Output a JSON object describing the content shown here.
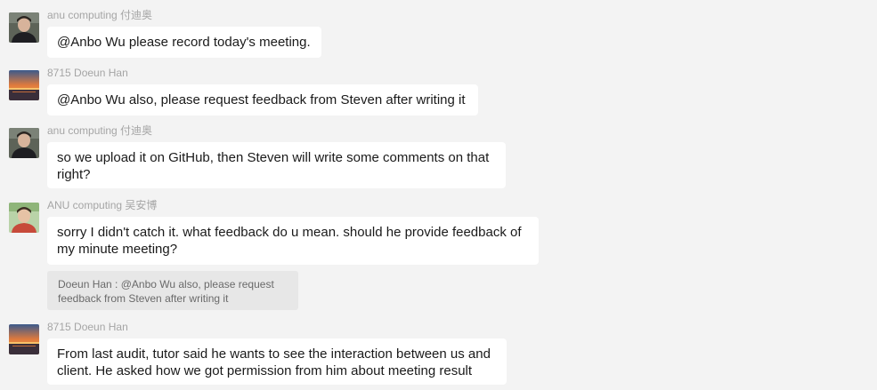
{
  "messages": [
    {
      "sender": "anu computing 付迪奥",
      "avatar_icon": "avatar-dark-portrait-icon",
      "text": "@Anbo Wu please record today's meeting."
    },
    {
      "sender": "8715 Doeun Han",
      "avatar_icon": "avatar-sunset-icon",
      "text": "@Anbo Wu also, please request feedback from Steven after writing it"
    },
    {
      "sender": "anu computing 付迪奥",
      "avatar_icon": "avatar-dark-portrait-icon",
      "text": "so we upload it on GitHub, then Steven will write some comments on that right?"
    },
    {
      "sender": "ANU computing 吴安博",
      "avatar_icon": "avatar-green-portrait-icon",
      "text": "sorry I didn't catch it. what feedback do u mean. should he provide feedback of my minute meeting?",
      "quote": "Doeun Han : @Anbo Wu also, please request feedback from Steven after writing it"
    },
    {
      "sender": "8715 Doeun Han",
      "avatar_icon": "avatar-sunset-icon",
      "text": "From last audit, tutor said he wants to see the interaction between us and client. He asked how we got permission from him about meeting result"
    }
  ],
  "colors": {
    "background": "#f3f3f3",
    "bubble": "#ffffff",
    "quote_background": "#e7e7e7",
    "sender_text": "#a5a5a5"
  }
}
